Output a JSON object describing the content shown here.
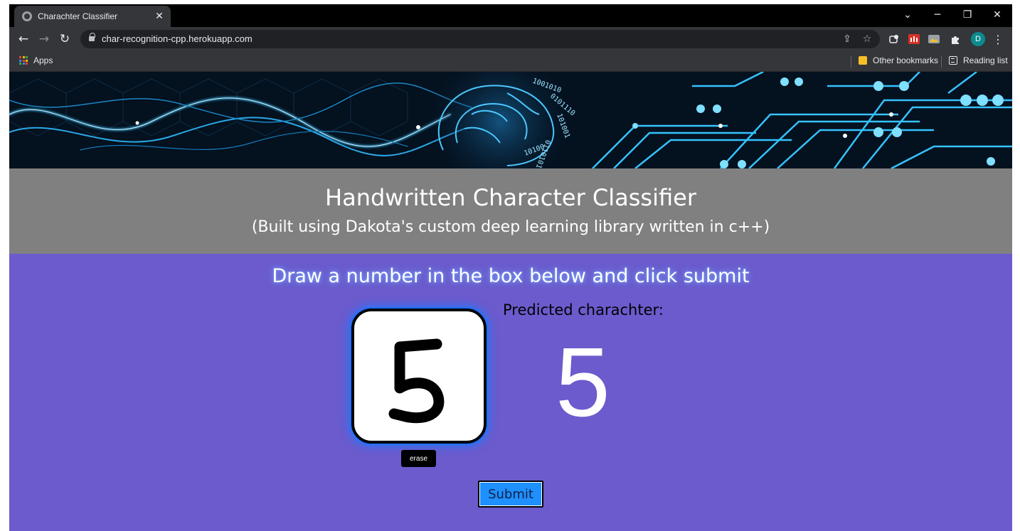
{
  "browser": {
    "tab_title": "Charachter Classifier",
    "tab_close": "✕",
    "url": "char-recognition-cpp.herokuapp.com",
    "bookmarks": {
      "apps_label": "Apps",
      "other_bookmarks": "Other bookmarks",
      "reading_list": "Reading list"
    },
    "profile_initial": "D",
    "icons": [
      "globe-icon",
      "back-icon",
      "forward-icon",
      "reload-icon",
      "lock-icon",
      "share-icon",
      "star-icon",
      "extension-icon",
      "profile-avatar",
      "kebab-menu-icon"
    ]
  },
  "page": {
    "title": "Handwritten Character Classifier",
    "subtitle": "(Built using Dakota's custom deep learning library written in c++)",
    "instruction": "Draw a number in the box below and click submit",
    "prediction_label": "Predicted charachter:",
    "prediction_value": "5",
    "erase_label": "erase",
    "submit_label": "Submit",
    "drawn_character": "5"
  },
  "colors": {
    "header_bg": "#808080",
    "main_bg": "#6b5bcd",
    "submit_bg": "#1e90ff",
    "canvas_glow": "#1f6fff",
    "banner_bg": "#04111f"
  }
}
